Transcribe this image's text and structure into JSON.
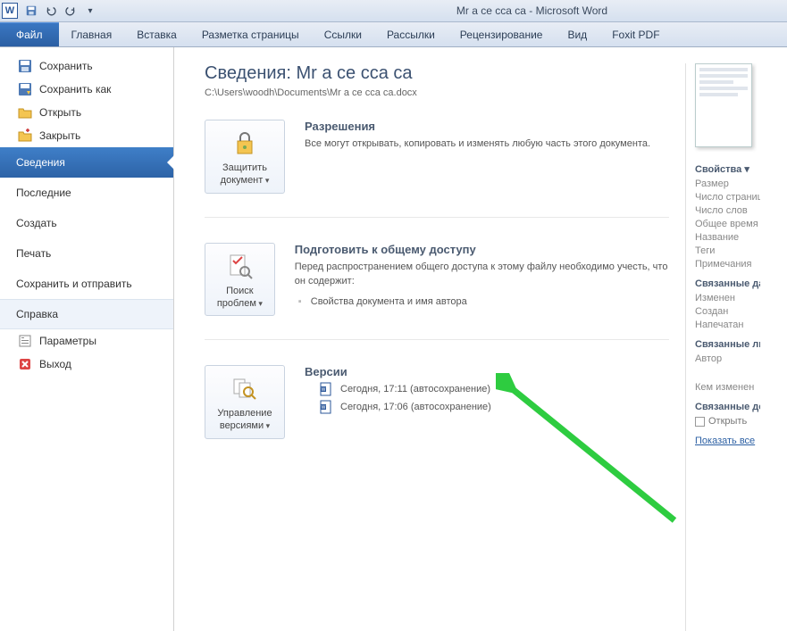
{
  "titlebar": {
    "title": "Mr a ce  cca ca  -  Microsoft Word"
  },
  "ribbon": {
    "file": "Файл",
    "tabs": [
      "Главная",
      "Вставка",
      "Разметка страницы",
      "Ссылки",
      "Рассылки",
      "Рецензирование",
      "Вид",
      "Foxit PDF"
    ]
  },
  "leftnav": {
    "save": "Сохранить",
    "saveas": "Сохранить как",
    "open": "Открыть",
    "close": "Закрыть",
    "info": "Сведения",
    "recent": "Последние",
    "new": "Создать",
    "print": "Печать",
    "sharesend": "Сохранить и отправить",
    "help": "Справка",
    "options": "Параметры",
    "exit": "Выход"
  },
  "info": {
    "heading": "Сведения: Mr a ce  cca ca",
    "path": "C:\\Users\\woodh\\Documents\\Mr a ce  cca ca.docx",
    "permissions": {
      "btn1": "Защитить",
      "btn2": "документ",
      "title": "Разрешения",
      "desc": "Все могут открывать, копировать и изменять любую часть этого документа."
    },
    "prepare": {
      "btn1": "Поиск",
      "btn2": "проблем",
      "title": "Подготовить к общему доступу",
      "desc": "Перед распространением общего доступа к этому файлу необходимо учесть, что он содержит:",
      "bullet": "Свойства документа и имя автора"
    },
    "versions": {
      "btn1": "Управление",
      "btn2": "версиями",
      "title": "Версии",
      "items": [
        "Сегодня, 17:11 (автосохранение)",
        "Сегодня, 17:06 (автосохранение)"
      ]
    }
  },
  "right": {
    "props_h": "Свойства ▾",
    "p1": "Размер",
    "p2": "Число страниц",
    "p3": "Число слов",
    "p4": "Общее время",
    "p5": "Название",
    "p6": "Теги",
    "p7": "Примечания",
    "h2": "Связанные даты",
    "p8": "Изменен",
    "p9": "Создан",
    "p10": "Напечатан",
    "h3": "Связанные люди",
    "p11": "Автор",
    "p12": "Кем изменен",
    "h4": "Связанные документы",
    "chk": "Открыть",
    "link": "Показать все"
  }
}
